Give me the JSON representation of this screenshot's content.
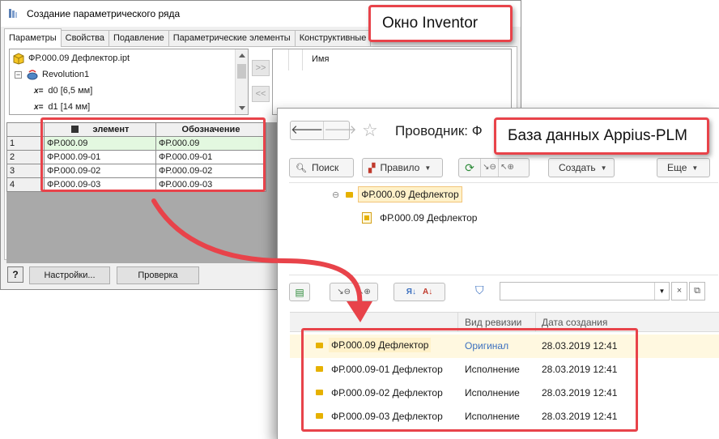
{
  "inventor": {
    "title": "Создание параметрического ряда",
    "tabs": [
      "Параметры",
      "Свойства",
      "Подавление",
      "Параметрические элементы",
      "Конструктивные"
    ],
    "tree": {
      "part": "ФР.000.09 Дефлектор.ipt",
      "feature": "Revolution1",
      "params": [
        "d0 [6,5 мм]",
        "d1 [14 мм]"
      ],
      "param_prefix": "x="
    },
    "move_right": ">>",
    "move_left": "<<",
    "name_list_header": "Имя",
    "grid": {
      "columns": [
        "элемент",
        "Обозначение"
      ],
      "rows": [
        {
          "n": "1",
          "element": "ФР.000.09",
          "designation": "ФР.000.09"
        },
        {
          "n": "2",
          "element": "ФР.000.09-01",
          "designation": "ФР.000.09-01"
        },
        {
          "n": "3",
          "element": "ФР.000.09-02",
          "designation": "ФР.000.09-02"
        },
        {
          "n": "4",
          "element": "ФР.000.09-03",
          "designation": "ФР.000.09-03"
        }
      ]
    },
    "help_label": "?",
    "settings_button": "Настройки...",
    "check_button": "Проверка"
  },
  "plm": {
    "back": "🡐",
    "forward": "🡒",
    "title": "Проводник: Ф",
    "toolbar": {
      "search": "Поиск",
      "rule": "Правило",
      "create": "Создать",
      "more": "Еще"
    },
    "tree": {
      "root": "ФР.000.09 Дефлектор",
      "child": "ФР.000.09 Дефлектор"
    },
    "list": {
      "columns": [
        "Вид ревизии",
        "Дата создания"
      ],
      "rows": [
        {
          "name": "ФР.000.09 Дефлектор",
          "revision": "Оригинал",
          "date": "28.03.2019 12:41"
        },
        {
          "name": "ФР.000.09-01 Дефлектор",
          "revision": "Исполнение",
          "date": "28.03.2019 12:41"
        },
        {
          "name": "ФР.000.09-02 Дефлектор",
          "revision": "Исполнение",
          "date": "28.03.2019 12:41"
        },
        {
          "name": "ФР.000.09-03 Дефлектор",
          "revision": "Исполнение",
          "date": "28.03.2019 12:41"
        }
      ]
    }
  },
  "callouts": {
    "inventor": "Окно Inventor",
    "plm": "База данных Appius-PLM"
  },
  "colors": {
    "accent_red": "#e8434a",
    "selected_row": "#e3f8e0",
    "plm_highlight": "#fff1c9",
    "revision_link": "#3a6fbf"
  }
}
